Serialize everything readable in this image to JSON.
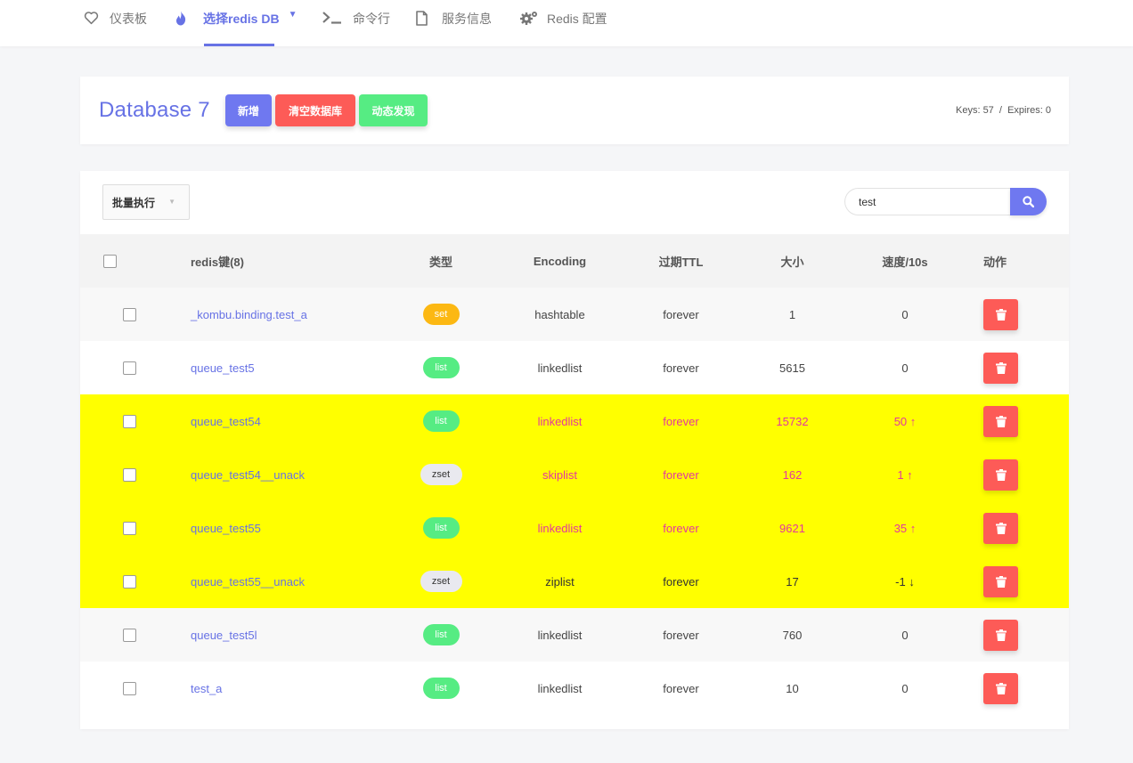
{
  "nav": {
    "items": [
      {
        "label": "仪表板",
        "icon": "heart-icon"
      },
      {
        "label": "选择redis DB",
        "icon": "flame-icon",
        "active": true
      },
      {
        "label": "命令行",
        "icon": "terminal-icon"
      },
      {
        "label": "服务信息",
        "icon": "file-icon"
      },
      {
        "label": "Redis 配置",
        "icon": "gears-icon"
      }
    ]
  },
  "db": {
    "title": "Database 7",
    "add_label": "新增",
    "clear_label": "清空数据库",
    "discover_label": "动态发现",
    "stats": "Keys: 57  /  Expires: 0"
  },
  "toolbar": {
    "batch_label": "批量执行",
    "search_value": "test"
  },
  "table": {
    "headers": {
      "key": "redis键(8)",
      "type": "类型",
      "encoding": "Encoding",
      "ttl": "过期TTL",
      "size": "大小",
      "speed": "速度/10s",
      "action": "动作"
    },
    "rows": [
      {
        "key": "_kombu.binding.test_a",
        "type": "set",
        "encoding": "hashtable",
        "ttl": "forever",
        "size": "1",
        "speed": "0"
      },
      {
        "key": "queue_test5",
        "type": "list",
        "encoding": "linkedlist",
        "ttl": "forever",
        "size": "5615",
        "speed": "0"
      },
      {
        "key": "queue_test54",
        "type": "list",
        "encoding": "linkedlist",
        "ttl": "forever",
        "size": "15732",
        "speed": "50 ↑"
      },
      {
        "key": "queue_test54__unack",
        "type": "zset",
        "encoding": "skiplist",
        "ttl": "forever",
        "size": "162",
        "speed": "1 ↑"
      },
      {
        "key": "queue_test55",
        "type": "list",
        "encoding": "linkedlist",
        "ttl": "forever",
        "size": "9621",
        "speed": "35 ↑"
      },
      {
        "key": "queue_test55__unack",
        "type": "zset",
        "encoding": "ziplist",
        "ttl": "forever",
        "size": "17",
        "speed": "-1 ↓"
      },
      {
        "key": "queue_test5l",
        "type": "list",
        "encoding": "linkedlist",
        "ttl": "forever",
        "size": "760",
        "speed": "0"
      },
      {
        "key": "test_a",
        "type": "list",
        "encoding": "linkedlist",
        "ttl": "forever",
        "size": "10",
        "speed": "0"
      }
    ]
  },
  "colors": {
    "accent": "#6772e5",
    "danger": "#fd5b57",
    "success": "#56ec83",
    "warning": "#fcb813",
    "highlight": "#ffff00",
    "highlight_text": "#e3399d"
  }
}
